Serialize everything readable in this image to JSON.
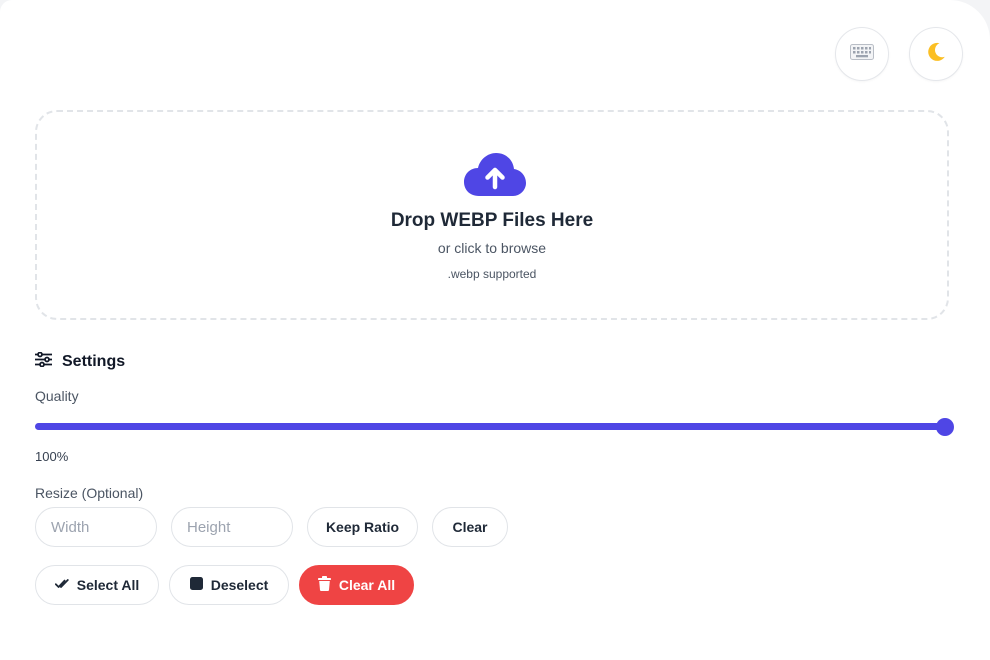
{
  "header": {
    "keyboard_icon": "keyboard-icon",
    "theme_icon": "moon-icon"
  },
  "dropzone": {
    "icon": "cloud-upload-icon",
    "title": "Drop WEBP Files Here",
    "subtitle": "or click to browse",
    "hint": ".webp supported"
  },
  "settings": {
    "title": "Settings",
    "icon": "sliders-icon",
    "quality_label": "Quality",
    "quality_value": 100,
    "quality_text": "100%",
    "resize_label": "Resize (Optional)",
    "width_placeholder": "Width",
    "height_placeholder": "Height",
    "keep_ratio_label": "Keep Ratio",
    "clear_label": "Clear"
  },
  "actions": {
    "select_all_label": "Select All",
    "deselect_label": "Deselect",
    "clear_all_label": "Clear All"
  },
  "colors": {
    "accent": "#4f46e5",
    "danger": "#ef4444",
    "moon": "#fbbf24"
  }
}
